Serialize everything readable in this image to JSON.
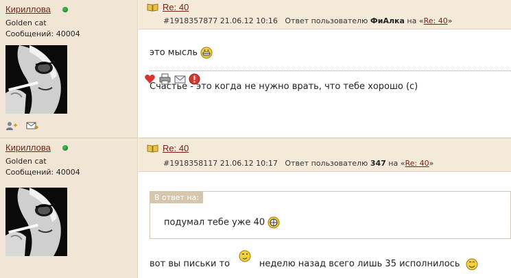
{
  "posts": [
    {
      "author": "Кириллова",
      "rank": "Golden cat",
      "messages": "Сообщений: 40004",
      "title": "Re: 40",
      "id_date": "#1918357877 21.06.12 10:16",
      "reply_prefix": "Ответ пользователю",
      "reply_user": "ФиАлка",
      "reply_on": "на «",
      "reply_link": "Re: 40",
      "reply_end": "»",
      "line1": "это мысль",
      "line2": "Счастье - это когда не нужно врать, что тебе хорошо (с)"
    },
    {
      "author": "Кириллова",
      "rank": "Golden cat",
      "messages": "Сообщений: 40004",
      "title": "Re: 40",
      "id_date": "#1918358117 21.06.12 10:17",
      "reply_prefix": "Ответ пользователю",
      "reply_user": "347",
      "reply_on": "на «",
      "reply_link": "Re: 40",
      "reply_end": "»",
      "quote_label": "В ответ на:",
      "quote_text": "подумал тебе уже 40",
      "reply_a": "вот вы письки то",
      "reply_b": "неделю назад всего лишь 35 исполнилось"
    }
  ],
  "colors": {
    "link": "#7a1f10",
    "sidebar": "#f1e6d6",
    "online": "#39b449"
  },
  "icons": {
    "online": "online-status-dot",
    "avatar": "user-avatar-photo",
    "add_friend": "add-friend-icon",
    "message": "send-message-icon",
    "book": "open-book-icon",
    "like": "heart-icon",
    "print": "print-icon",
    "mail": "mail-icon",
    "report": "report-icon"
  }
}
